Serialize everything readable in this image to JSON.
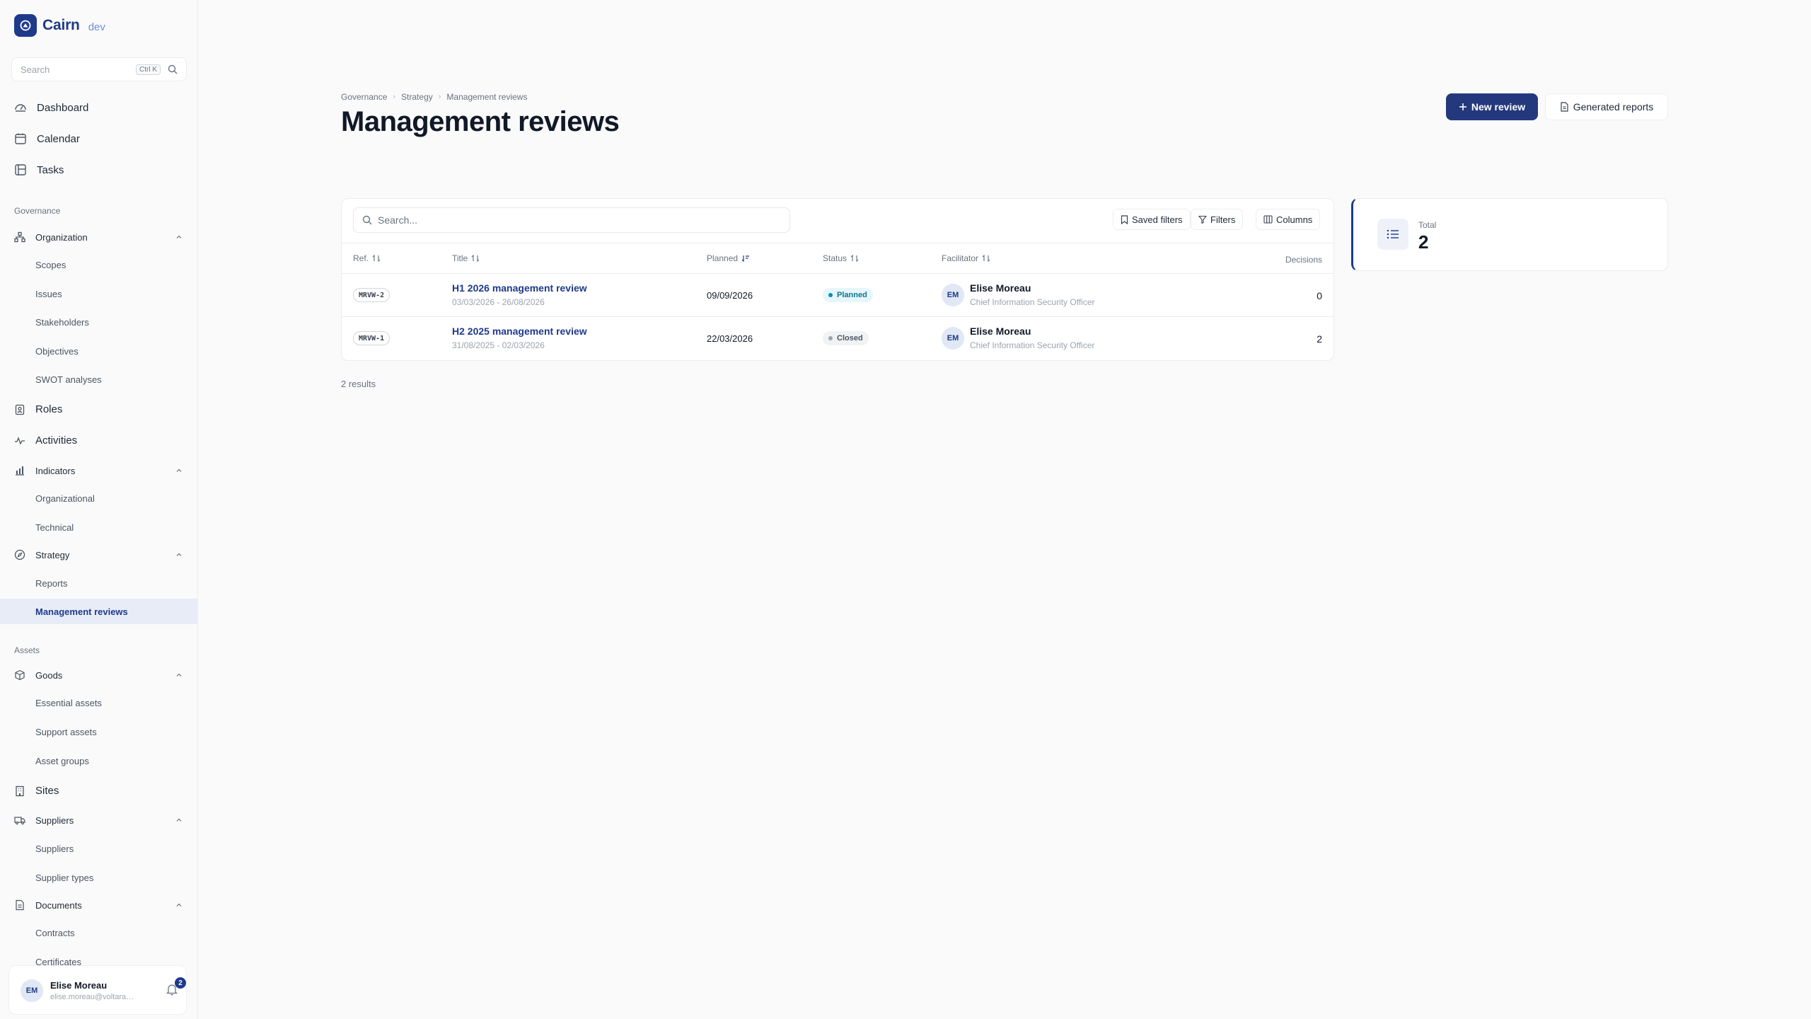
{
  "brand": {
    "name": "Cairn",
    "env": "dev"
  },
  "sidebar": {
    "search_placeholder": "Search",
    "search_shortcut": "Ctrl K",
    "top_items": [
      {
        "label": "Dashboard",
        "icon": "dashboard-icon"
      },
      {
        "label": "Calendar",
        "icon": "calendar-icon"
      },
      {
        "label": "Tasks",
        "icon": "tasks-icon"
      }
    ],
    "governance_label": "Governance",
    "organization": {
      "label": "Organization",
      "children": [
        "Scopes",
        "Issues",
        "Stakeholders",
        "Objectives",
        "SWOT analyses"
      ]
    },
    "roles": "Roles",
    "activities": "Activities",
    "indicators": {
      "label": "Indicators",
      "children": [
        "Organizational",
        "Technical"
      ]
    },
    "strategy": {
      "label": "Strategy",
      "children": [
        "Reports",
        "Management reviews"
      ]
    },
    "assets_label": "Assets",
    "goods": {
      "label": "Goods",
      "children": [
        "Essential assets",
        "Support assets",
        "Asset groups"
      ]
    },
    "sites": "Sites",
    "suppliers": {
      "label": "Suppliers",
      "children": [
        "Suppliers",
        "Supplier types"
      ]
    },
    "documents": {
      "label": "Documents",
      "children": [
        "Contracts",
        "Certificates"
      ]
    }
  },
  "user": {
    "initials": "EM",
    "name": "Elise Moreau",
    "email": "elise.moreau@voltara.exa...",
    "notifications": "2"
  },
  "page": {
    "breadcrumb": [
      "Governance",
      "Strategy",
      "Management reviews"
    ],
    "title": "Management reviews",
    "new_button": "New review",
    "reports_button": "Generated reports"
  },
  "table": {
    "search_placeholder": "Search...",
    "saved_filters": "Saved filters",
    "filters": "Filters",
    "columns_btn": "Columns",
    "columns": {
      "ref": "Ref.",
      "title": "Title",
      "planned": "Planned",
      "status": "Status",
      "facilitator": "Facilitator",
      "decisions": "Decisions"
    },
    "rows": [
      {
        "ref": "MRVW-2",
        "title": "H1 2026 management review",
        "dates": "03/03/2026 - 26/08/2026",
        "planned": "09/09/2026",
        "status": "Planned",
        "facilitator_initials": "EM",
        "facilitator_name": "Elise Moreau",
        "facilitator_role": "Chief Information Security Officer",
        "decisions": "0"
      },
      {
        "ref": "MRVW-1",
        "title": "H2 2025 management review",
        "dates": "31/08/2025 - 02/03/2026",
        "planned": "22/03/2026",
        "status": "Closed",
        "facilitator_initials": "EM",
        "facilitator_name": "Elise Moreau",
        "facilitator_role": "Chief Information Security Officer",
        "decisions": "2"
      }
    ],
    "results_text": "2 results"
  },
  "stat": {
    "label": "Total",
    "value": "2"
  },
  "colors": {
    "accent": "#1e3a8a",
    "primary_button": "#24397d",
    "planned": "#0891b2",
    "closed": "#9ca3af"
  }
}
